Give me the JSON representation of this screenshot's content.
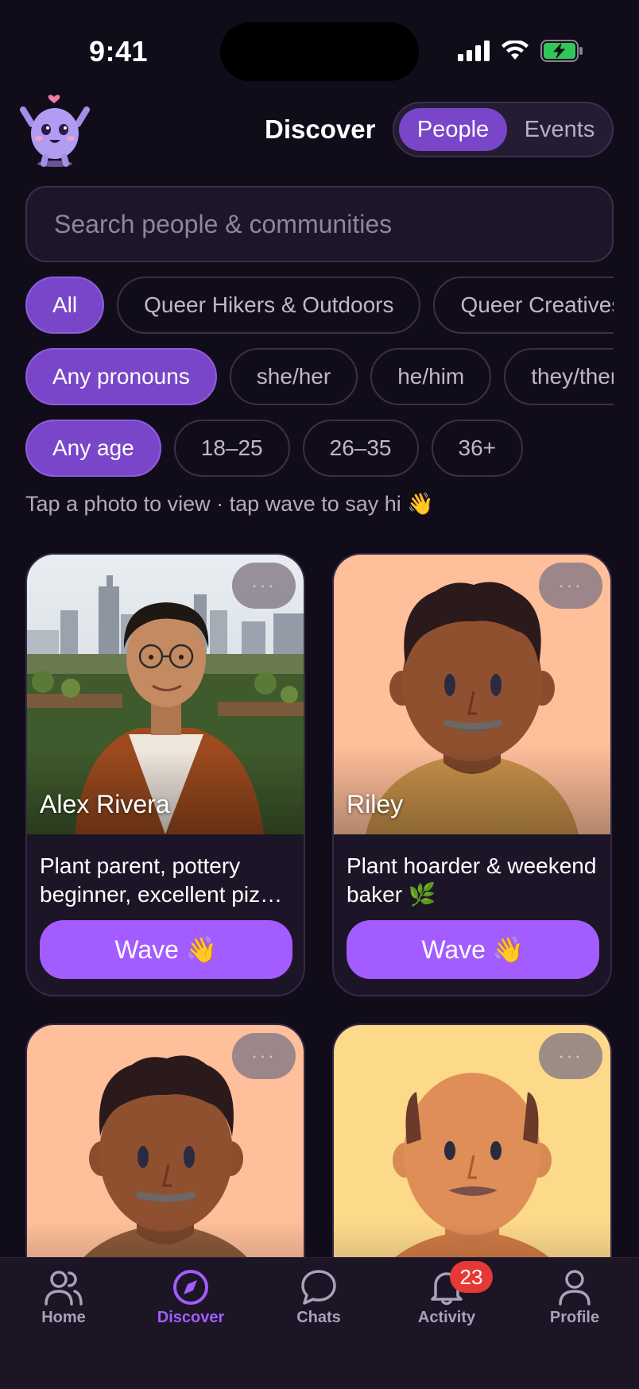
{
  "status_bar": {
    "time": "9:41"
  },
  "header": {
    "title": "Discover",
    "segments": [
      "People",
      "Events"
    ],
    "active_segment": "People"
  },
  "search": {
    "placeholder": "Search people & communities",
    "value": ""
  },
  "filters": {
    "communities": [
      "All",
      "Queer Hikers & Outdoors",
      "Queer Creatives"
    ],
    "pronouns": [
      "Any pronouns",
      "she/her",
      "he/him",
      "they/them"
    ],
    "ages": [
      "Any age",
      "18–25",
      "26–35",
      "36+"
    ]
  },
  "hint": "Tap a photo to view · tap wave to say hi 👋",
  "cards": [
    {
      "name": "Alex Rivera",
      "bio": "Plant parent, pottery beginner, excellent pizza maker.",
      "button": "Wave 👋"
    },
    {
      "name": "Riley",
      "bio": "Plant hoarder & weekend baker 🌿",
      "button": "Wave 👋"
    },
    {
      "name": "",
      "bio": "",
      "button": ""
    },
    {
      "name": "",
      "bio": "",
      "button": ""
    }
  ],
  "more_label": "···",
  "tabs": [
    {
      "label": "Home",
      "icon": "people-icon"
    },
    {
      "label": "Discover",
      "icon": "compass-icon",
      "active": true
    },
    {
      "label": "Chats",
      "icon": "chat-bubble-icon"
    },
    {
      "label": "Activity",
      "icon": "bell-icon",
      "badge": "23"
    },
    {
      "label": "Profile",
      "icon": "person-icon"
    }
  ],
  "colors": {
    "accent": "#a35cff",
    "chip_active": "#7a46c9",
    "background": "#110c1a",
    "badge": "#e53935"
  }
}
